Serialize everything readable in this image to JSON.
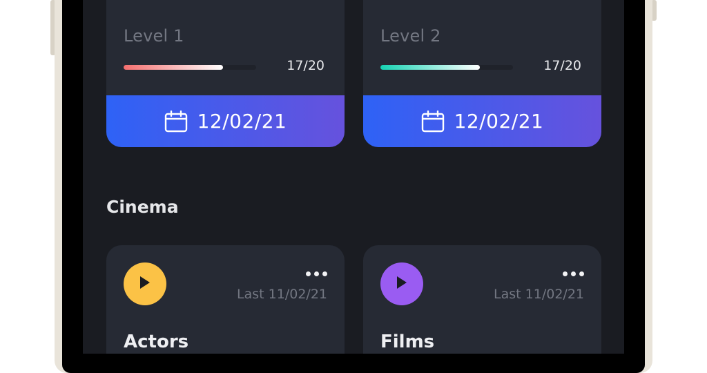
{
  "levels": [
    {
      "title": "Level 1",
      "count": "17/20",
      "progress": 0.75,
      "date": "12/02/21",
      "bar_color": "#f46f6f"
    },
    {
      "title": "Level 2",
      "count": "17/20",
      "progress": 0.75,
      "date": "12/02/21",
      "bar_color": "#16d3b3"
    }
  ],
  "section": {
    "title": "Cinema"
  },
  "categories": [
    {
      "title": "Actors",
      "last": "Last 11/02/21",
      "icon": "play-icon",
      "color": "#fbc246"
    },
    {
      "title": "Films",
      "last": "Last 11/02/21",
      "icon": "play-icon",
      "color": "#9a5cf2"
    }
  ],
  "colors": {
    "background": "#1a1c22",
    "card": "#262a34",
    "accent_start": "#2e62f6",
    "accent_end": "#6652dd"
  }
}
